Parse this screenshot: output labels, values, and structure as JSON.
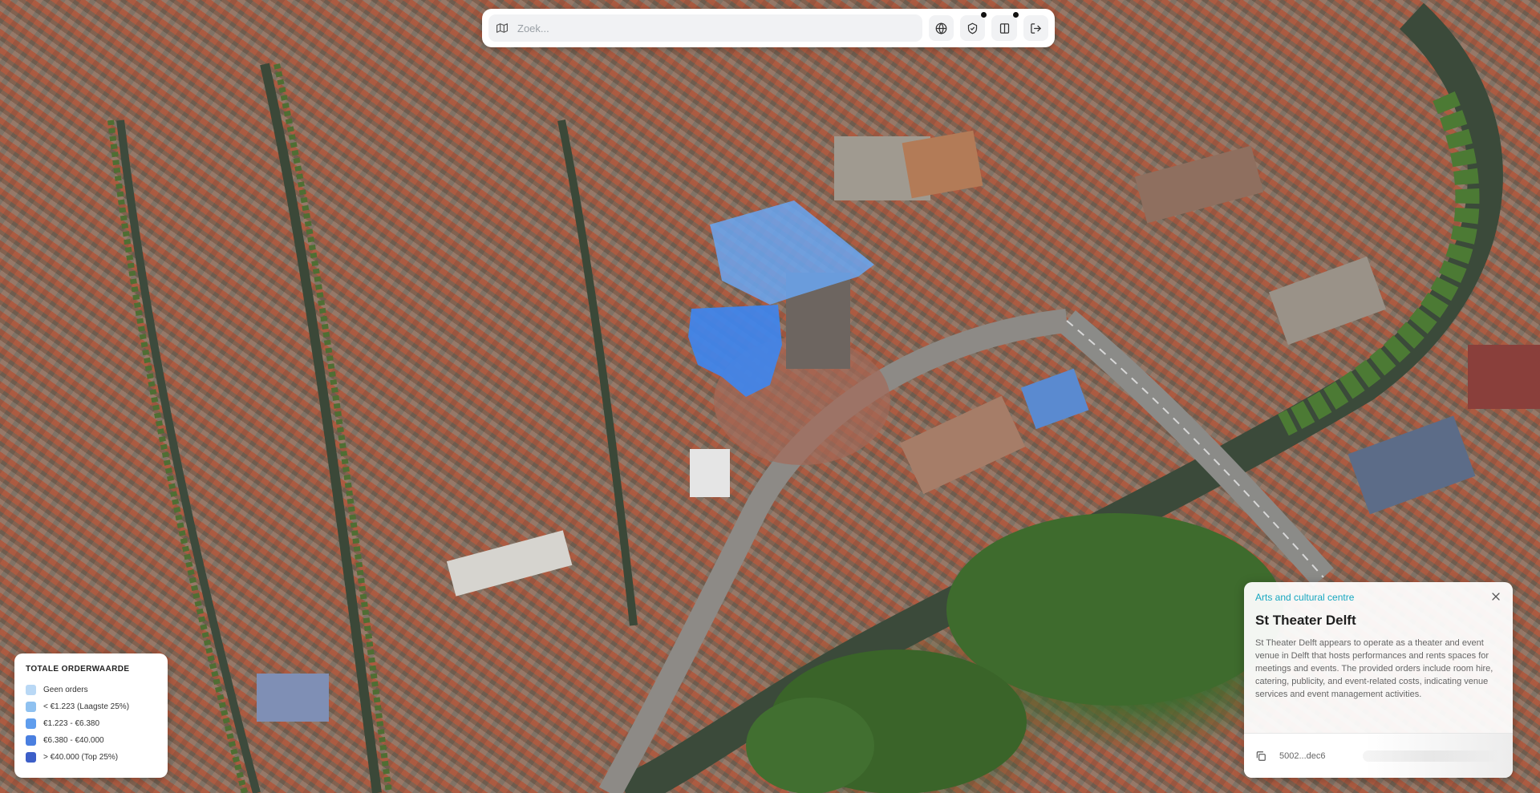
{
  "search": {
    "placeholder": "Zoek..."
  },
  "toolbar": {
    "buttons": [
      {
        "icon": "globe-icon"
      },
      {
        "icon": "shield-icon",
        "has_indicator": true
      },
      {
        "icon": "panel-icon",
        "has_indicator": true
      },
      {
        "icon": "logout-icon"
      }
    ]
  },
  "legend": {
    "title": "TOTALE ORDERWAARDE",
    "items": [
      {
        "label": "Geen orders",
        "color": "#b9d8f5"
      },
      {
        "label": "< €1.223 (Laagste 25%)",
        "color": "#8fc1f0"
      },
      {
        "label": "€1.223 - €6.380",
        "color": "#5f9ded"
      },
      {
        "label": "€6.380 - €40.000",
        "color": "#4a7fe0"
      },
      {
        "label": "> €40.000 (Top 25%)",
        "color": "#3d5fc8"
      }
    ]
  },
  "info_card": {
    "category": "Arts and cultural centre",
    "title": "St Theater Delft",
    "description": "St Theater Delft appears to operate as a theater and event venue in Delft that hosts performances and rents spaces for meetings and events. The provided orders include room hire, catering, publicity, and event-related costs, indicating venue services and event management activities.",
    "id": "5002...dec6",
    "accent_color": "#17a7c0"
  },
  "highlight_color": "#4a8ff0"
}
